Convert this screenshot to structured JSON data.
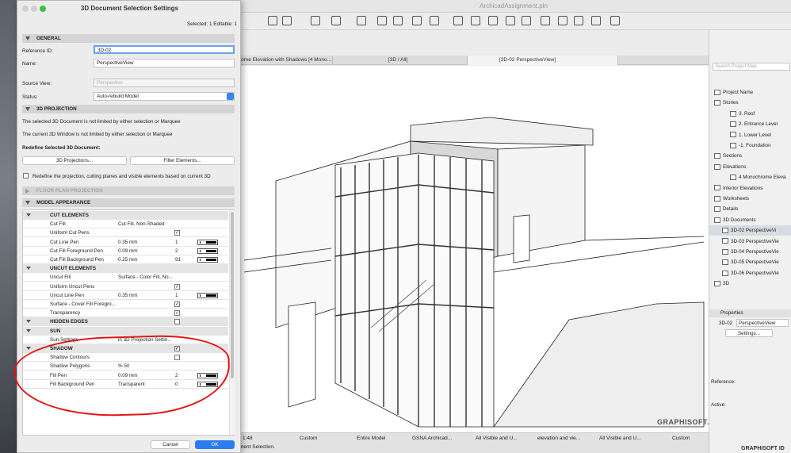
{
  "app": {
    "title": "ArchicadAssignment.pln",
    "tabs": [
      "rome Elevation with Shadows [4 Mono...",
      "[3D / All]",
      "[3D-02 PerspectiveView]"
    ],
    "status": {
      "scale": "1:48",
      "custom1": "Custom",
      "model": "Entire Model",
      "gsna": "GSNA Archicad...",
      "visible1": "All Visible and U...",
      "elevation": "elevation and vie...",
      "visible2": "All Visible and U...",
      "custom2": "Custom",
      "message": "ment Selection."
    },
    "logo": "GRAPHISOFT.",
    "brand_id": "GRAPHISOFT ID"
  },
  "navigator": {
    "search_placeholder": "Search Project Map",
    "items": [
      {
        "label": "Project Name"
      },
      {
        "label": "Stories"
      },
      {
        "label": "3. Roof"
      },
      {
        "label": "2. Entrance Level"
      },
      {
        "label": "1. Lower Level"
      },
      {
        "label": "-1. Foundation"
      },
      {
        "label": "Sections"
      },
      {
        "label": "Elevations"
      },
      {
        "label": "4 Monochrome Eleva"
      },
      {
        "label": "Interior Elevations"
      },
      {
        "label": "Worksheets"
      },
      {
        "label": "Details"
      },
      {
        "label": "3D Documents"
      },
      {
        "label": "3D-02 PerspectiveVi"
      },
      {
        "label": "3D-03 PerspectiveVie"
      },
      {
        "label": "3D-04 PerspectiveVie"
      },
      {
        "label": "3D-05 PerspectiveVie"
      },
      {
        "label": "3D-06 PerspectiveVie"
      },
      {
        "label": "3D"
      }
    ],
    "properties": {
      "heading": "Properties",
      "id": "3D-02",
      "name": "PerspectiveView",
      "settings_btn": "Settings..."
    },
    "reference_label": "Reference:",
    "active_label": "Active:"
  },
  "dialog": {
    "title": "3D Document Selection Settings",
    "selected_info": "Selected: 1 Editable: 1",
    "general": {
      "heading": "GENERAL",
      "ref_label": "Reference ID:",
      "ref_value": "3D-02",
      "name_label": "Name:",
      "name_value": "PerspectiveView",
      "source_label": "Source View:",
      "source_value": "Perspective",
      "status_label": "Status:",
      "status_value": "Auto-rebuild Model"
    },
    "projection": {
      "heading": "3D PROJECTION",
      "line1": "The selected 3D Document is not limited by either selection or Marquee",
      "line2": "The current 3D Window is not limited by either selection or Marquee",
      "redefine_heading": "Redefine Selected 3D Document:",
      "btn_projections": "3D Projections...",
      "btn_filter": "Filter Elements...",
      "redefine_check": "Redefine the projection, cutting planes and visible elements based on current 3D"
    },
    "floor_plan": "FLOOR PLAN PROJECTION",
    "model_appearance": "MODEL APPEARANCE",
    "rows": [
      {
        "label": "CUT ELEMENTS",
        "kind": "group"
      },
      {
        "label": "Cut Fill",
        "value": "Cut Fill, Non-Shaded"
      },
      {
        "label": "Uniform Cut Pens",
        "value": "",
        "check": "✓"
      },
      {
        "label": "Cut Line Pen",
        "value": "0.35 mm",
        "num": "1"
      },
      {
        "label": "Cut Fill Foreground Pen",
        "value": "0.09 mm",
        "num": "2"
      },
      {
        "label": "Cut Fill Background Pen",
        "value": "0.25 mm",
        "num": "91"
      },
      {
        "label": "UNCUT ELEMENTS",
        "kind": "group"
      },
      {
        "label": "Uncut Fill",
        "value": "Surface - Color Fill, No..."
      },
      {
        "label": "Uniform Uncut Pens",
        "value": "",
        "check": "✓"
      },
      {
        "label": "Uncut Line Pen",
        "value": "0.35 mm",
        "num": "1"
      },
      {
        "label": "Surface - Cover Fill Foregro...",
        "value": "",
        "check": "✓"
      },
      {
        "label": "Transparency",
        "value": "",
        "check": "✓"
      },
      {
        "label": "HIDDEN EDGES",
        "kind": "group",
        "check": ""
      },
      {
        "label": "SUN",
        "kind": "group"
      },
      {
        "label": "Sun Settings",
        "value": "in 3D Projection Settin..."
      },
      {
        "label": "SHADOW",
        "kind": "group",
        "check": "✓"
      },
      {
        "label": "Shadow Contours",
        "value": "",
        "check": ""
      },
      {
        "label": "Shadow Polygons",
        "value": "% 50"
      },
      {
        "label": "Fill Pen",
        "value": "0.09 mm",
        "num": "2"
      },
      {
        "label": "Fill Background Pen",
        "value": "Transparent",
        "num": "0"
      }
    ],
    "cancel": "Cancel",
    "ok": "OK"
  }
}
